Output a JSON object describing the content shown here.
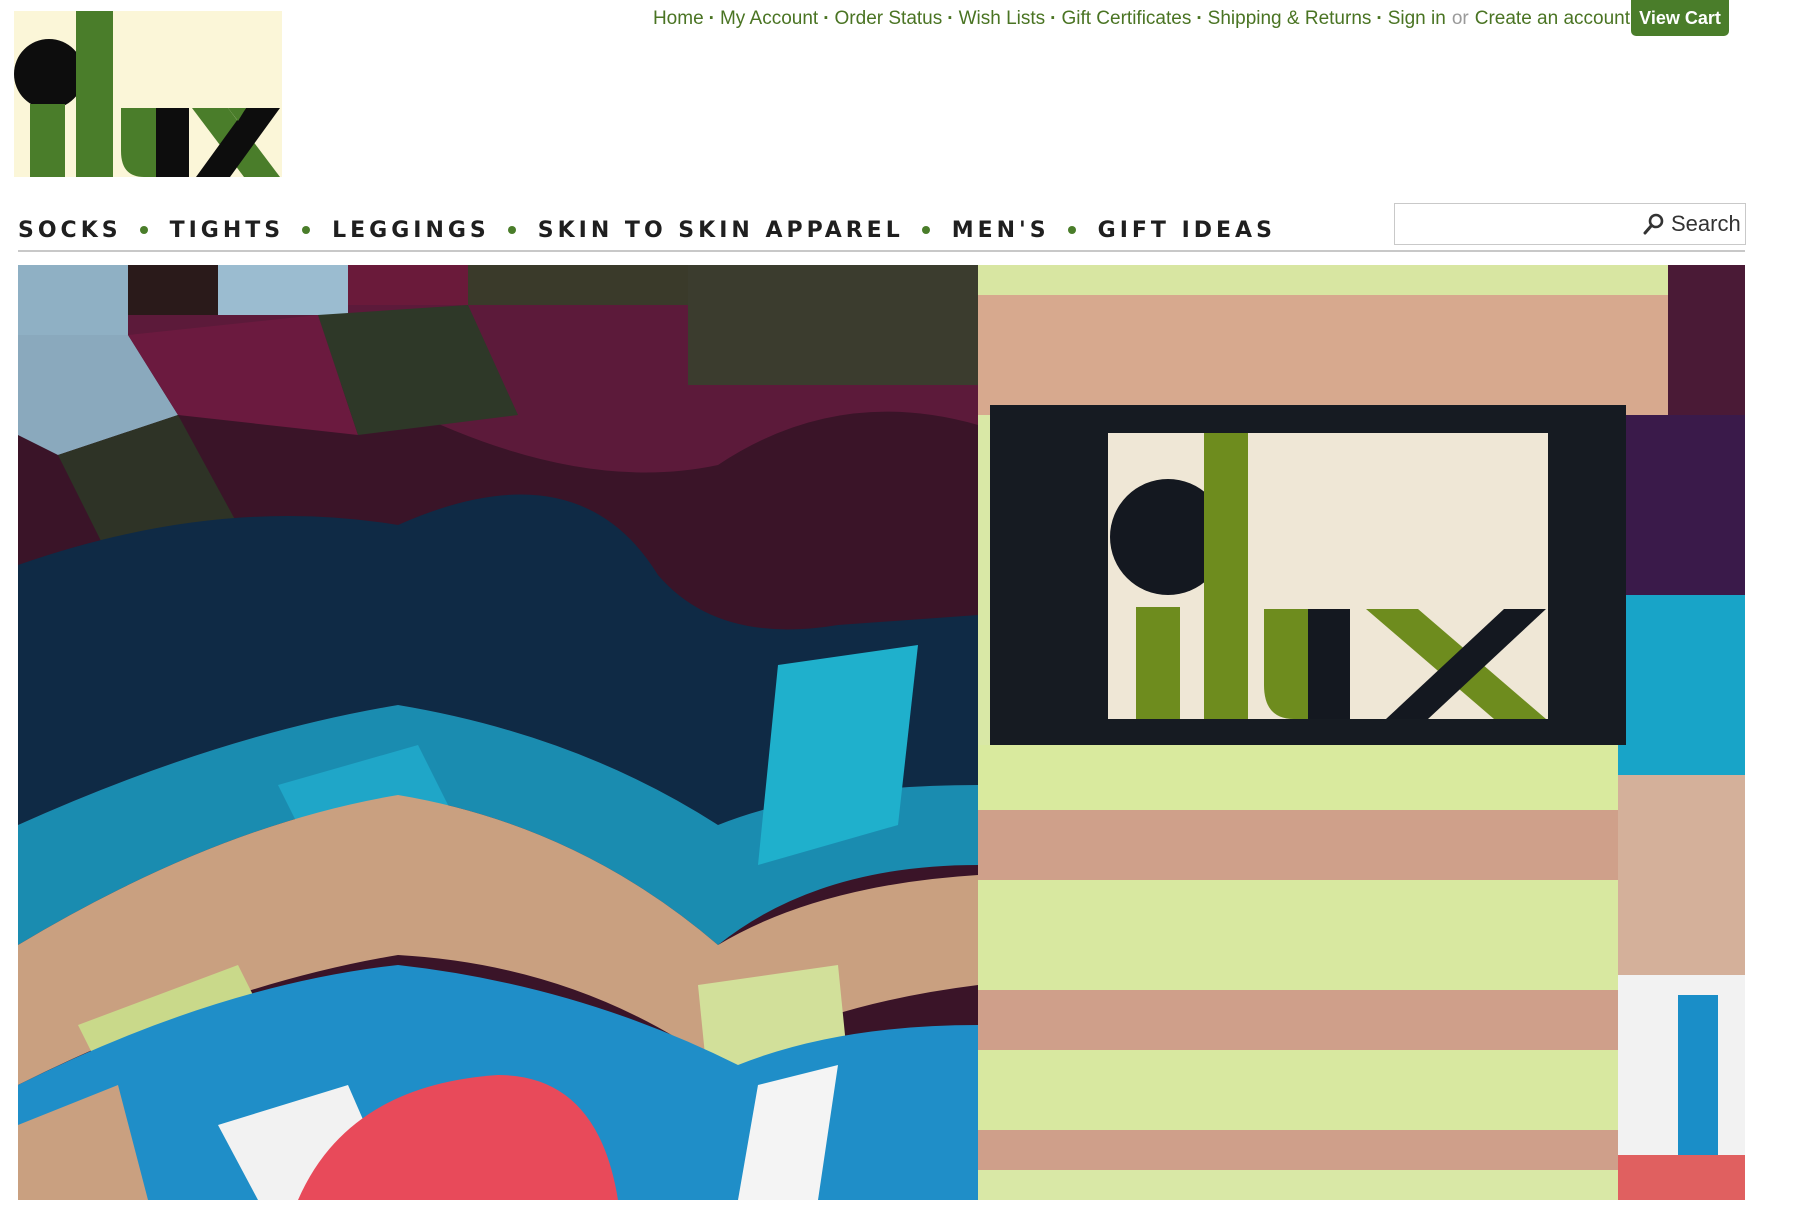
{
  "brand": {
    "logo_text": "ilux"
  },
  "util_nav": {
    "links": [
      "Home",
      "My Account",
      "Order Status",
      "Wish Lists",
      "Gift Certificates",
      "Shipping & Returns",
      "Sign in"
    ],
    "or_text": "or",
    "create_account": "Create an account",
    "view_cart": "View Cart"
  },
  "main_nav": {
    "items": [
      "SOCKS",
      "TIGHTS",
      "LEGGINGS",
      "SKIN TO SKIN APPAREL",
      "MEN'S",
      "GIFT IDEAS"
    ]
  },
  "search": {
    "placeholder": "",
    "button_label": "Search",
    "icon": "search-icon"
  },
  "colors": {
    "brand_green": "#4a7d2a",
    "link_green": "#4a7423",
    "logo_cream": "#fbf6d8",
    "logo_black": "#0d0d0d"
  }
}
